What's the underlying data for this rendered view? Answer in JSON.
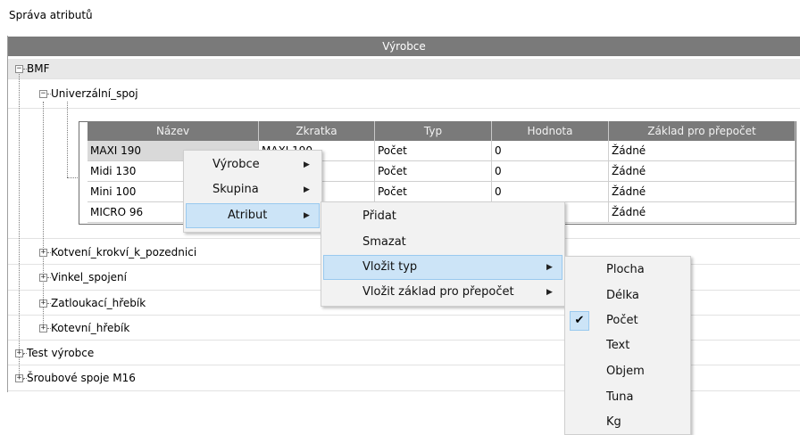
{
  "window": {
    "title": "Správa atributů"
  },
  "outer_grid": {
    "header": "Výrobce"
  },
  "tree": {
    "root": "BMF",
    "child_open": "Univerzální_spoj",
    "children": [
      "Kotvení_krokví_k_pozednici",
      "Vinkel_spojení",
      "Zatloukací_hřebík",
      "Kotevní_hřebík"
    ],
    "siblings": [
      "Test výrobce",
      "Šroubové spoje M16"
    ]
  },
  "inner_grid": {
    "columns": [
      "Název",
      "Zkratka",
      "Typ",
      "Hodnota",
      "Základ pro přepočet"
    ],
    "rows": [
      [
        "MAXI 190",
        "MAXI 190",
        "Počet",
        "0",
        "Žádné"
      ],
      [
        "Midi 130",
        "",
        "Počet",
        "0",
        "Žádné"
      ],
      [
        "Mini 100",
        "",
        "Počet",
        "0",
        "Žádné"
      ],
      [
        "MICRO 96",
        "",
        "",
        "",
        "Žádné"
      ]
    ]
  },
  "context_menu": {
    "items": [
      "Výrobce",
      "Skupina",
      "Atribut"
    ],
    "highlighted": "Atribut"
  },
  "submenu_atribut": {
    "items": [
      "Přidat",
      "Smazat",
      "Vložit typ",
      "Vložit základ pro přepočet"
    ],
    "highlighted": "Vložit typ"
  },
  "submenu_typ": {
    "items": [
      "Plocha",
      "Délka",
      "Počet",
      "Text",
      "Objem",
      "Tuna",
      "Kg"
    ],
    "checked": "Počet",
    "check_glyph": "✔"
  },
  "glyphs": {
    "expand": "+",
    "collapse": "−",
    "submenu_arrow": "▶"
  },
  "colors": {
    "header_bg": "#7a7a7a",
    "highlight_bg": "#cce4f7",
    "highlight_border": "#99c9ef",
    "menu_bg": "#f2f2f2"
  }
}
